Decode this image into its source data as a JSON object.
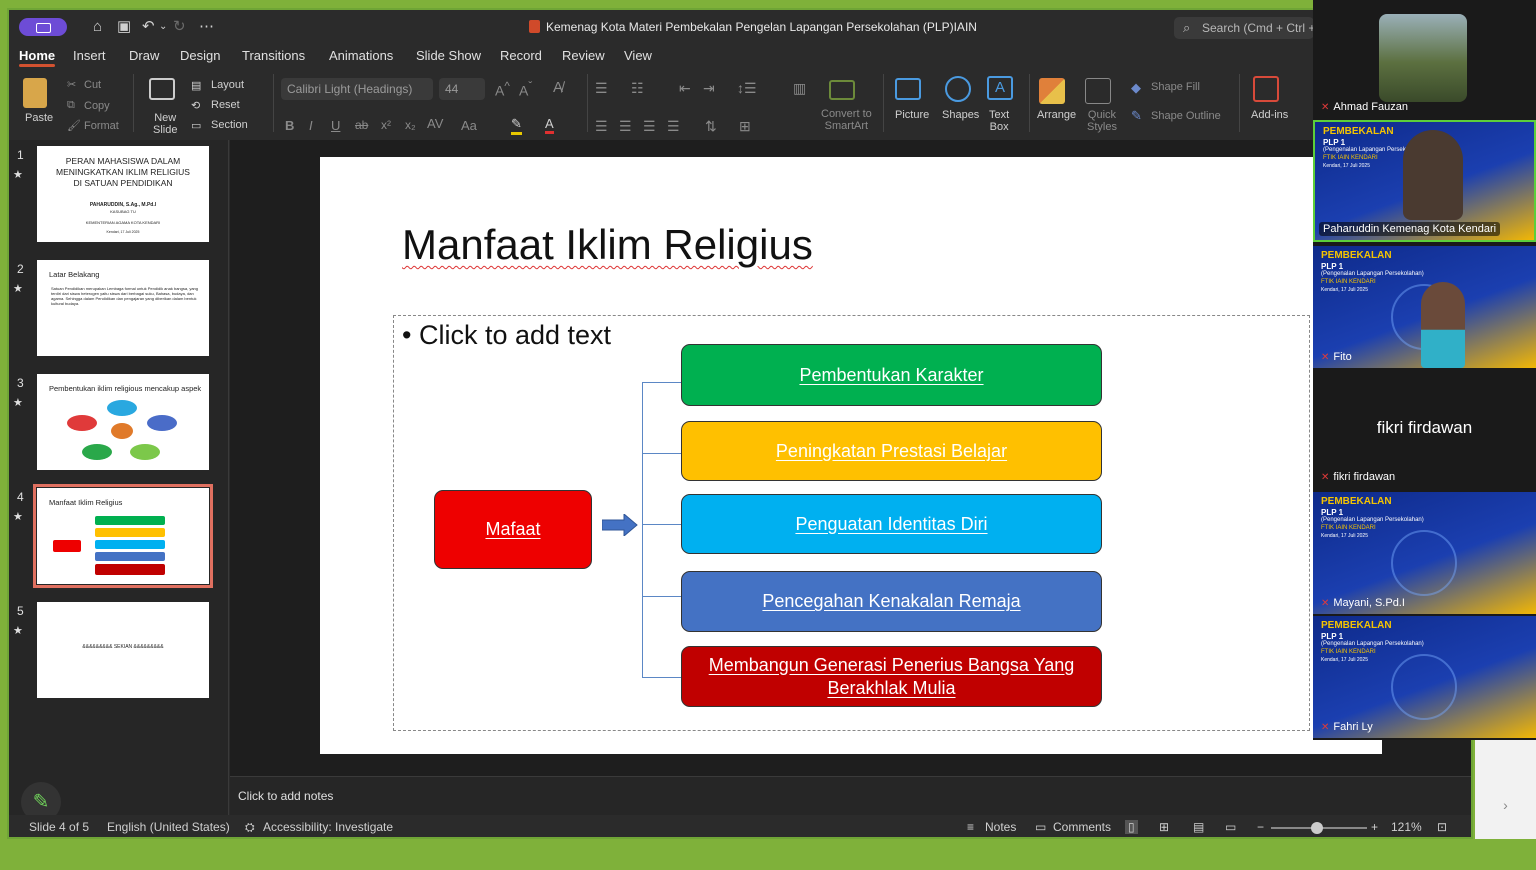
{
  "window": {
    "title": "Kemenag Kota Materi Pembekalan Pengelan Lapangan Persekolahan (PLP)IAIN",
    "search_placeholder": "Search (Cmd + Ctrl +"
  },
  "tabs": [
    "Home",
    "Insert",
    "Draw",
    "Design",
    "Transitions",
    "Animations",
    "Slide Show",
    "Record",
    "Review",
    "View"
  ],
  "ribbon": {
    "paste": "Paste",
    "cut": "Cut",
    "copy": "Copy",
    "format": "Format",
    "new_slide": "New\nSlide",
    "layout": "Layout",
    "reset": "Reset",
    "section": "Section",
    "font_name": "Calibri Light (Headings)",
    "font_size": "44",
    "convert_smartart": "Convert to\nSmartArt",
    "picture": "Picture",
    "shapes": "Shapes",
    "text_box": "Text\nBox",
    "arrange": "Arrange",
    "quick_styles": "Quick\nStyles",
    "shape_fill": "Shape Fill",
    "shape_outline": "Shape Outline",
    "addins": "Add-ins"
  },
  "thumbnails": [
    {
      "num": "1",
      "title": "PERAN MAHASISWA DALAM MENINGKATKAN IKLIM RELIGIUS DI SATUAN PENDIDIKAN",
      "author": "PAHARUDDIN, S.Ag., M.Pd.I",
      "role": "KASUBAG TU",
      "org": "KEMENTERIAN AGAMA KOTA KENDARI",
      "date": "Kendari, 17 Juli 2025"
    },
    {
      "num": "2",
      "title": "Latar Belakang",
      "body": "Satuan Pendidikan merupakan Lembaga formal untuk Pendidik anak bangsa, yang terdiri dari siswa heterogen yaitu siswa dari berbagai suku, Bahasa, budaya, dan agama. Sehingga dalam Pendidikan dan pengajaran yang diberikan dalam bentuk kultural budaya."
    },
    {
      "num": "3",
      "title": "Pembentukan iklim religious mencakup aspek"
    },
    {
      "num": "4",
      "title": "Manfaat Iklim Religius"
    },
    {
      "num": "5",
      "title": "&&&&&&&&&   SEKIAN   &&&&&&&&&"
    }
  ],
  "slide": {
    "title": "Manfaat Iklim Religius",
    "bullet": "Click to add text",
    "source_box": {
      "label": "Mafaat",
      "color": "#ee0000"
    },
    "items": [
      {
        "label": "Pembentukan Karakter",
        "color": "#00b050"
      },
      {
        "label": "Peningkatan Prestasi Belajar",
        "color": "#ffc000"
      },
      {
        "label": "Penguatan Identitas Diri",
        "color": "#00b0f0"
      },
      {
        "label": "Pencegahan Kenakalan Remaja",
        "color": "#4472c4"
      },
      {
        "label": "Membangun Generasi Penerius Bangsa Yang Berakhlak Mulia",
        "color": "#c00000"
      }
    ]
  },
  "notes_placeholder": "Click to add notes",
  "status": {
    "slide": "Slide 4 of 5",
    "language": "English (United States)",
    "accessibility": "Accessibility: Investigate",
    "notes": "Notes",
    "comments": "Comments",
    "zoom": "121%"
  },
  "participants": [
    {
      "name": "Ahmad Fauzan",
      "type": "photo"
    },
    {
      "name": "Paharuddin Kemenag Kota Kendari",
      "type": "speaker"
    },
    {
      "name": "Fito",
      "type": "banner"
    },
    {
      "name": "fikri firdawan",
      "type": "name"
    },
    {
      "name": "Mayani, S.Pd.I",
      "type": "banner"
    },
    {
      "name": "Fahri Ly",
      "type": "banner"
    }
  ],
  "banner": {
    "line1": "PEMBEKALAN",
    "line2": "PLP 1",
    "line3": "(Pengenalan Lapangan Persekolahan)",
    "line4": "FTIK IAIN KENDARI",
    "line5": "Kendari, 17 Juli 2025"
  }
}
